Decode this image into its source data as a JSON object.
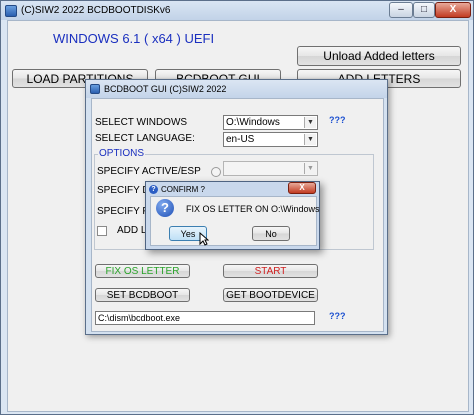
{
  "main_window": {
    "title": "(C)SIW2 2022 BCDBOOTDISKv6",
    "windows_info": "WINDOWS 6.1 ( x64 ) UEFI",
    "unload_label": "Unload Added letters",
    "load_partitions_label": "LOAD PARTITIONS",
    "bcdboot_gui_label": "BCDBOOT GUI",
    "add_letters_label": "ADD LETTERS",
    "controls": {
      "minimize": "–",
      "maximize": "□",
      "close": "X"
    }
  },
  "bcd_window": {
    "title": "BCDBOOT GUI (C)SIW2 2022",
    "select_windows_label": "SELECT WINDOWS",
    "select_windows_value": "O:\\Windows",
    "select_language_label": "SELECT LANGUAGE:",
    "select_language_value": "en-US",
    "help_mark": "???",
    "options_legend": "OPTIONS",
    "specify_active_label": "SPECIFY ACTIVE/ESP",
    "specify_device_label": "SPECIFY DE",
    "specify_firmware_label": "SPECIFY FIR",
    "add_label": "ADD LA",
    "fix_os_letter_label": "FIX OS LETTER",
    "start_label": "START",
    "set_bcdboot_label": "SET BCDBOOT",
    "get_bootdevice_label": "GET BOOTDEVICE",
    "exe_path_value": "C:\\dism\\bcdboot.exe",
    "exe_help_mark": "???",
    "colors": {
      "fix_os_letter": "#2aa32a",
      "start": "#d02020"
    }
  },
  "confirm_dialog": {
    "title": "CONFIRM ?",
    "message": "FIX OS LETTER ON  O:\\Windows",
    "yes_label": "Yes",
    "no_label": "No",
    "close": "X",
    "icon": "question-icon"
  }
}
